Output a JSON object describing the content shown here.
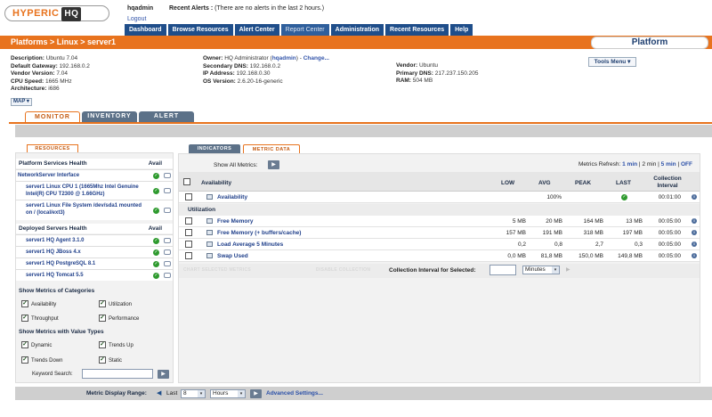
{
  "header": {
    "logo_text": "HYPERIC",
    "logo_hq": "HQ",
    "user": "hqadmin",
    "logout": "Logout",
    "alerts_label": "Recent Alerts :",
    "alerts_text": "(There are no alerts in the last 2 hours.)",
    "nav": [
      "Dashboard",
      "Browse Resources",
      "Alert Center",
      "Report Center",
      "Administration",
      "Recent Resources",
      "Help"
    ],
    "breadcrumb": "Platforms > Linux > server1",
    "platform_tab": "Platform"
  },
  "info": {
    "col1": [
      {
        "label": "Description:",
        "value": "Ubuntu 7.04"
      },
      {
        "label": "Default Gateway:",
        "value": "192.168.0.2"
      },
      {
        "label": "Vendor Version:",
        "value": "7.04"
      },
      {
        "label": "CPU Speed:",
        "value": "1665 MHz"
      },
      {
        "label": "Architecture:",
        "value": "i686"
      }
    ],
    "col2": [
      {
        "label": "Owner:",
        "value": "HQ Administrator (",
        "user": "hqadmin",
        "value2": ") - ",
        "link": "Change..."
      },
      {
        "label": "Secondary DNS:",
        "value": "192.168.0.2"
      },
      {
        "label": "IP Address:",
        "value": "192.168.0.30"
      },
      {
        "label": "OS Version:",
        "value": "2.6.20-16-generic"
      }
    ],
    "col3": [
      {
        "label": "Vendor:",
        "value": "Ubuntu"
      },
      {
        "label": "Primary DNS:",
        "value": "217.237.150.205"
      },
      {
        "label": "RAM:",
        "value": "504 MB"
      }
    ],
    "tools_menu": "Tools Menu",
    "map": "MAP"
  },
  "tabs": [
    "MONITOR",
    "INVENTORY",
    "ALERT"
  ],
  "left": {
    "resources_tab": "RESOURCES",
    "platform_services_head": "Platform Services Health",
    "avail": "Avail",
    "platform_services": [
      "NetworkServer Interface",
      "server1 Linux CPU 1 (1665Mhz Intel Genuine Intel(R) CPU T2300 @ 1.66GHz)",
      "server1 Linux File System /dev/sda1 mounted on / (local/ext3)"
    ],
    "deployed_head": "Deployed Servers Health",
    "deployed": [
      "server1 HQ Agent 3.1.0",
      "server1 HQ JBoss 4.x",
      "server1 HQ PostgreSQL 8.1",
      "server1 HQ Tomcat 5.5"
    ],
    "categories_head": "Show Metrics of Categories",
    "categories": [
      "Availability",
      "Utilization",
      "Throughput",
      "Performance"
    ],
    "value_types_head": "Show Metrics with Value Types",
    "value_types": [
      "Dynamic",
      "Trends Up",
      "Trends Down",
      "Static"
    ],
    "keyword_label": "Keyword Search:"
  },
  "right": {
    "indicators_tab": "INDICATORS",
    "metric_data_tab": "METRIC DATA",
    "show_all": "Show All Metrics:",
    "refresh_label": "Metrics Refresh:",
    "refresh_opts": [
      "1 min",
      "2 min",
      "5 min",
      "OFF"
    ],
    "columns": [
      "Availability",
      "LOW",
      "AVG",
      "PEAK",
      "LAST",
      "Collection Interval"
    ],
    "avail_row": {
      "name": "Availability",
      "avg": "100%",
      "interval": "00:01:00"
    },
    "group_util": "Utilization",
    "metrics": [
      {
        "name": "Free Memory",
        "low": "5 MB",
        "avg": "20 MB",
        "peak": "164 MB",
        "last": "13 MB",
        "interval": "00:05:00"
      },
      {
        "name": "Free Memory (+ buffers/cache)",
        "low": "157 MB",
        "avg": "191 MB",
        "peak": "318 MB",
        "last": "197 MB",
        "interval": "00:05:00"
      },
      {
        "name": "Load Average 5 Minutes",
        "low": "0,2",
        "avg": "0,8",
        "peak": "2,7",
        "last": "0,3",
        "interval": "00:05:00"
      },
      {
        "name": "Swap Used",
        "low": "0,0 MB",
        "avg": "81,8 MB",
        "peak": "150,0 MB",
        "last": "149,8 MB",
        "interval": "00:05:00"
      }
    ],
    "chart_selected": "CHART SELECTED METRICS",
    "disable_collection": "DISABLE COLLECTION",
    "interval_label": "Collection Interval for Selected:",
    "interval_unit": "Minutes"
  },
  "bottom": {
    "range_label": "Metric Display Range:",
    "last": "Last",
    "last_value": "8",
    "unit": "Hours",
    "advanced": "Advanced Settings..."
  }
}
